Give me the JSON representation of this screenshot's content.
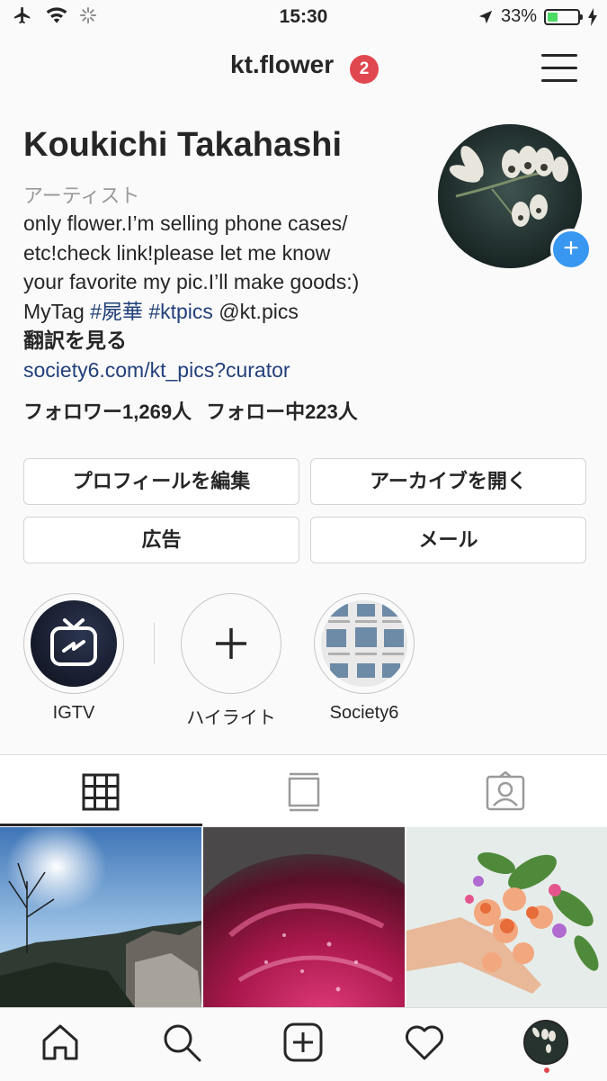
{
  "status_bar": {
    "time": "15:30",
    "battery_percent": "33%",
    "battery_level": 0.33,
    "icons": [
      "airplane-icon",
      "wifi-icon",
      "activity-spinner-icon",
      "location-arrow-icon",
      "battery-icon",
      "charging-bolt-icon"
    ]
  },
  "header": {
    "username": "kt.flower",
    "notification_count": "2"
  },
  "profile": {
    "full_name": "Koukichi Takahashi",
    "category": "アーティスト",
    "bio_line1": "only flower.I’m selling phone cases/",
    "bio_line2": "etc!check link!please let me know",
    "bio_line3": "your favorite my pic.I’ll make goods:)",
    "bio_line4_prefix": "MyTag ",
    "tag1": "#屍華",
    "tag2": "#ktpics",
    "mention": " @kt.pics",
    "translate": "翻訳を見る",
    "website": "society6.com/kt_pics?curator",
    "followers": "フォロワー1,269人",
    "following": "フォロー中223人"
  },
  "buttons": {
    "edit_profile": "プロフィールを編集",
    "open_archive": "アーカイブを開く",
    "ads": "広告",
    "email": "メール"
  },
  "highlights": [
    {
      "label": "IGTV"
    },
    {
      "label": "ハイライト"
    },
    {
      "label": "Society6"
    }
  ],
  "tabs": [
    "grid-tab",
    "feed-tab",
    "tagged-tab"
  ],
  "nav": [
    "home",
    "search",
    "new-post",
    "activity",
    "profile"
  ],
  "colors": {
    "accent_blue": "#3897f0",
    "badge_red": "#e0474f",
    "link_blue": "#22407a",
    "battery_green": "#4cd964"
  }
}
